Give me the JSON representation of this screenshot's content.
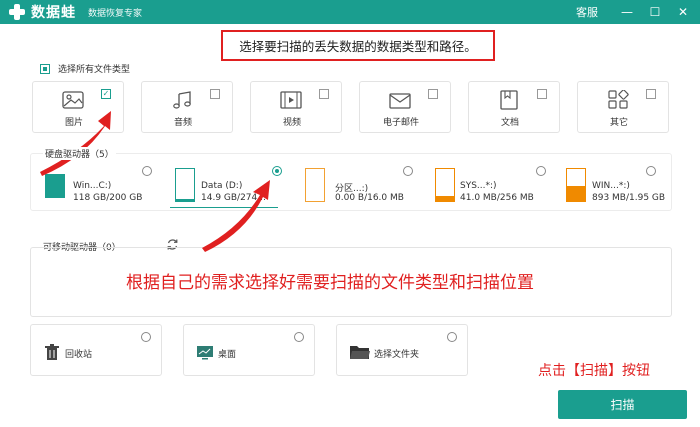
{
  "titlebar": {
    "brand": "数据蛙",
    "subtitle": "数据恢复专家",
    "service": "客服",
    "minimize": "—",
    "maximize": "☐",
    "close": "✕"
  },
  "instruction": "选择要扫描的丢失数据的数据类型和路径。",
  "select_all_label": "选择所有文件类型",
  "file_types": [
    {
      "label": "图片",
      "checked": true
    },
    {
      "label": "音频",
      "checked": false
    },
    {
      "label": "视频",
      "checked": false
    },
    {
      "label": "电子邮件",
      "checked": false
    },
    {
      "label": "文档",
      "checked": false
    },
    {
      "label": "其它",
      "checked": false
    }
  ],
  "drives_header": "硬盘驱动器（5）",
  "drives": [
    {
      "name": "Win...C:)",
      "size": "118 GB/200 GB",
      "selected": false
    },
    {
      "name": "Data (D:)",
      "size": "14.9 GB/274...",
      "selected": true
    },
    {
      "name": "分区...:)",
      "size": "0.00  B/16.0 MB",
      "selected": false
    },
    {
      "name": "SYS...*:)",
      "size": "41.0 MB/256 MB",
      "selected": false
    },
    {
      "name": "WIN...*:)",
      "size": "893 MB/1.95 GB",
      "selected": false
    }
  ],
  "removable_header": "可移动驱动器（0）",
  "annotation_middle": "根据自己的需求选择好需要扫描的文件类型和扫描位置",
  "locations": [
    {
      "label": "回收站",
      "icon": "trash-icon"
    },
    {
      "label": "桌面",
      "icon": "desktop-icon"
    },
    {
      "label": "选择文件夹",
      "icon": "folder-icon"
    }
  ],
  "annotation_button": "点击【扫描】按钮",
  "scan_button": "扫描",
  "colors": {
    "accent": "#1a9e8f",
    "annotation": "#e02020",
    "drive_fill": "#f08a00"
  }
}
